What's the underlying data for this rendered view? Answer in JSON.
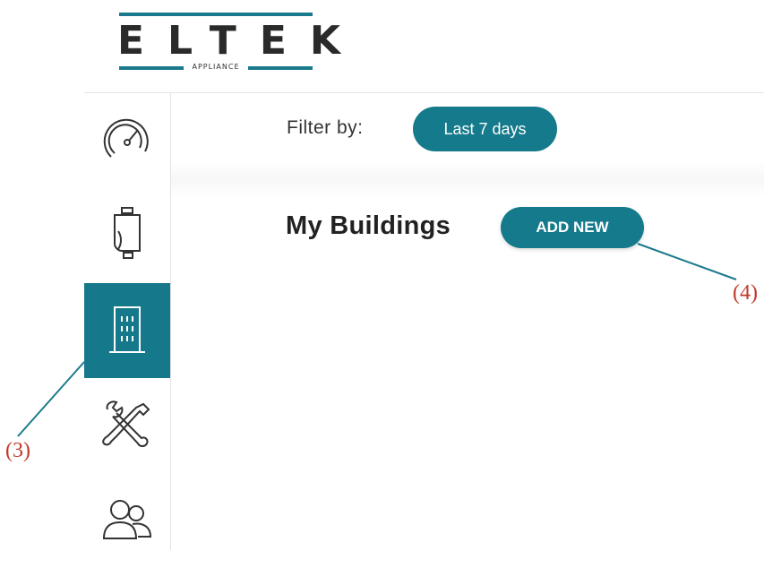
{
  "brand": {
    "name": "ELTEK",
    "subtitle": "APPLIANCE",
    "accent_color": "#157a8c"
  },
  "sidebar": {
    "items": [
      {
        "icon": "speedometer-icon",
        "active": false
      },
      {
        "icon": "water-heater-device-icon",
        "active": false
      },
      {
        "icon": "building-icon",
        "active": true
      },
      {
        "icon": "tools-icon",
        "active": false
      },
      {
        "icon": "users-icon",
        "active": false
      }
    ]
  },
  "filter": {
    "label": "Filter by:",
    "selected": "Last 7 days"
  },
  "main": {
    "heading": "My Buildings",
    "add_button": "ADD NEW"
  },
  "annotations": {
    "sidebar_callout": "(3)",
    "add_callout": "(4)",
    "color": "#c0392b"
  }
}
